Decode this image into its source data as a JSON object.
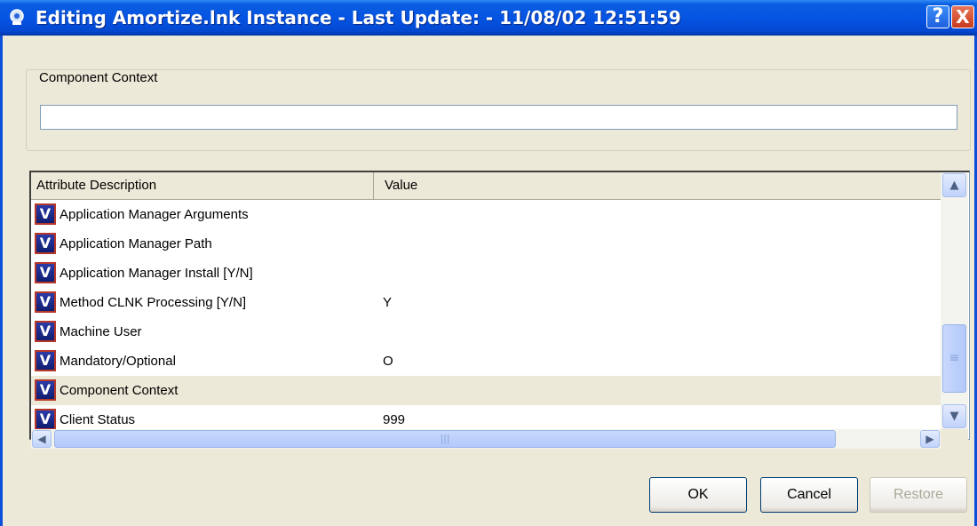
{
  "window": {
    "title": "Editing Amortize.lnk Instance - Last Update: - 11/08/02 12:51:59",
    "help_glyph": "?",
    "close_glyph": "X"
  },
  "context": {
    "legend": "Component Context",
    "value": ""
  },
  "grid": {
    "columns": [
      "Attribute Description",
      "Value"
    ],
    "icon_letter": "V",
    "rows": [
      {
        "desc": "Application Manager Arguments",
        "value": ""
      },
      {
        "desc": "Application Manager Path",
        "value": ""
      },
      {
        "desc": "Application Manager Install [Y/N]",
        "value": ""
      },
      {
        "desc": "Method CLNK Processing [Y/N]",
        "value": "Y"
      },
      {
        "desc": "Machine User",
        "value": ""
      },
      {
        "desc": "Mandatory/Optional",
        "value": "O"
      },
      {
        "desc": "Component Context",
        "value": "",
        "selected": true
      },
      {
        "desc": "Client Status",
        "value": "999"
      }
    ]
  },
  "buttons": {
    "ok": "OK",
    "cancel": "Cancel",
    "restore": "Restore"
  },
  "colors": {
    "titlebar": "#0554e3",
    "close": "#c9381a",
    "selected_row": "#ece9d8"
  }
}
